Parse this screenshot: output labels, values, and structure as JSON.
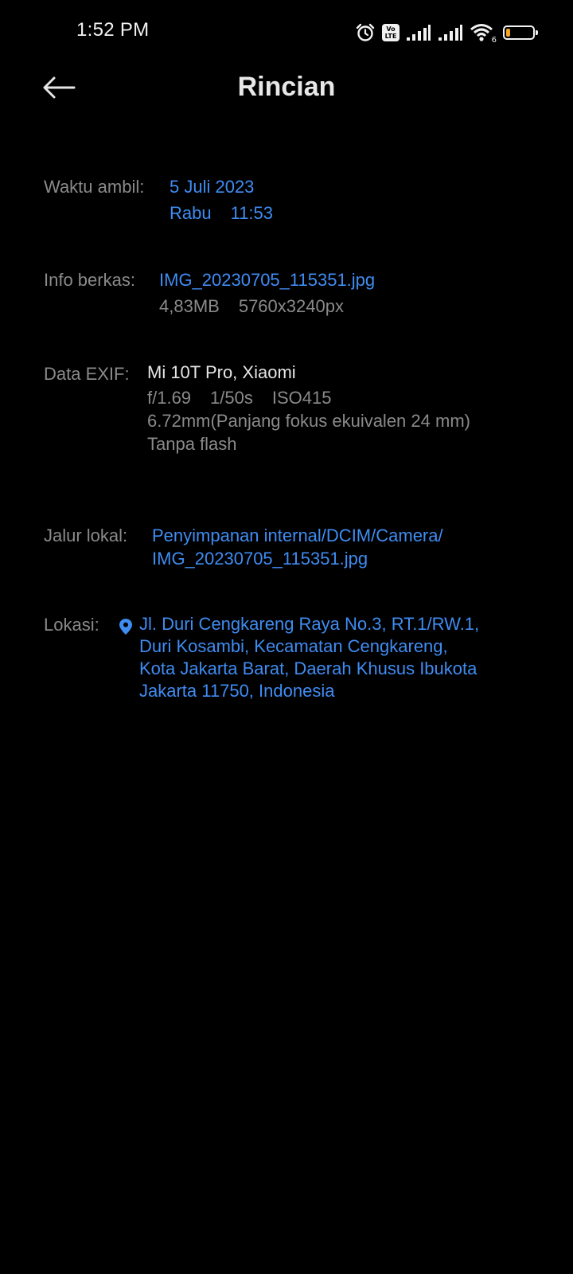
{
  "status_bar": {
    "time": "1:52 PM",
    "volte_top": "Vo",
    "volte_bottom": "LTE",
    "wifi_badge": "6",
    "battery_level": 0.15,
    "battery_color": "#f5a623"
  },
  "header": {
    "title": "Rincian",
    "back_icon": "arrow-left-icon"
  },
  "details": {
    "waktu": {
      "label": "Waktu ambil:",
      "date": "5 Juli 2023",
      "day": "Rabu",
      "time": "11:53"
    },
    "info": {
      "label": "Info berkas:",
      "filename": "IMG_20230705_115351.jpg",
      "size": "4,83MB",
      "resolution": "5760x3240px"
    },
    "exif": {
      "label": "Data EXIF:",
      "device": "Mi 10T Pro, Xiaomi",
      "aperture": "f/1.69",
      "shutter": "1/50s",
      "iso": "ISO415",
      "focal": "6.72mm(Panjang fokus ekuivalen 24 mm)",
      "flash": "Tanpa flash"
    },
    "jalur": {
      "label": "Jalur lokal:",
      "path_line1": "Penyimpanan internal/DCIM/Camera/",
      "path_line2": "IMG_20230705_115351.jpg"
    },
    "lokasi": {
      "label": "Lokasi:",
      "icon": "location-pin-icon",
      "line1": "Jl. Duri Cengkareng Raya No.3, RT.1/RW.1,",
      "line2": "Duri Kosambi, Kecamatan Cengkareng,",
      "line3": "Kota Jakarta Barat, Daerah Khusus Ibukota",
      "line4": "Jakarta 11750, Indonesia"
    }
  },
  "colors": {
    "background": "#000000",
    "link": "#3f8cf2",
    "label": "#8a8a8a",
    "text": "#e6e6e6"
  }
}
